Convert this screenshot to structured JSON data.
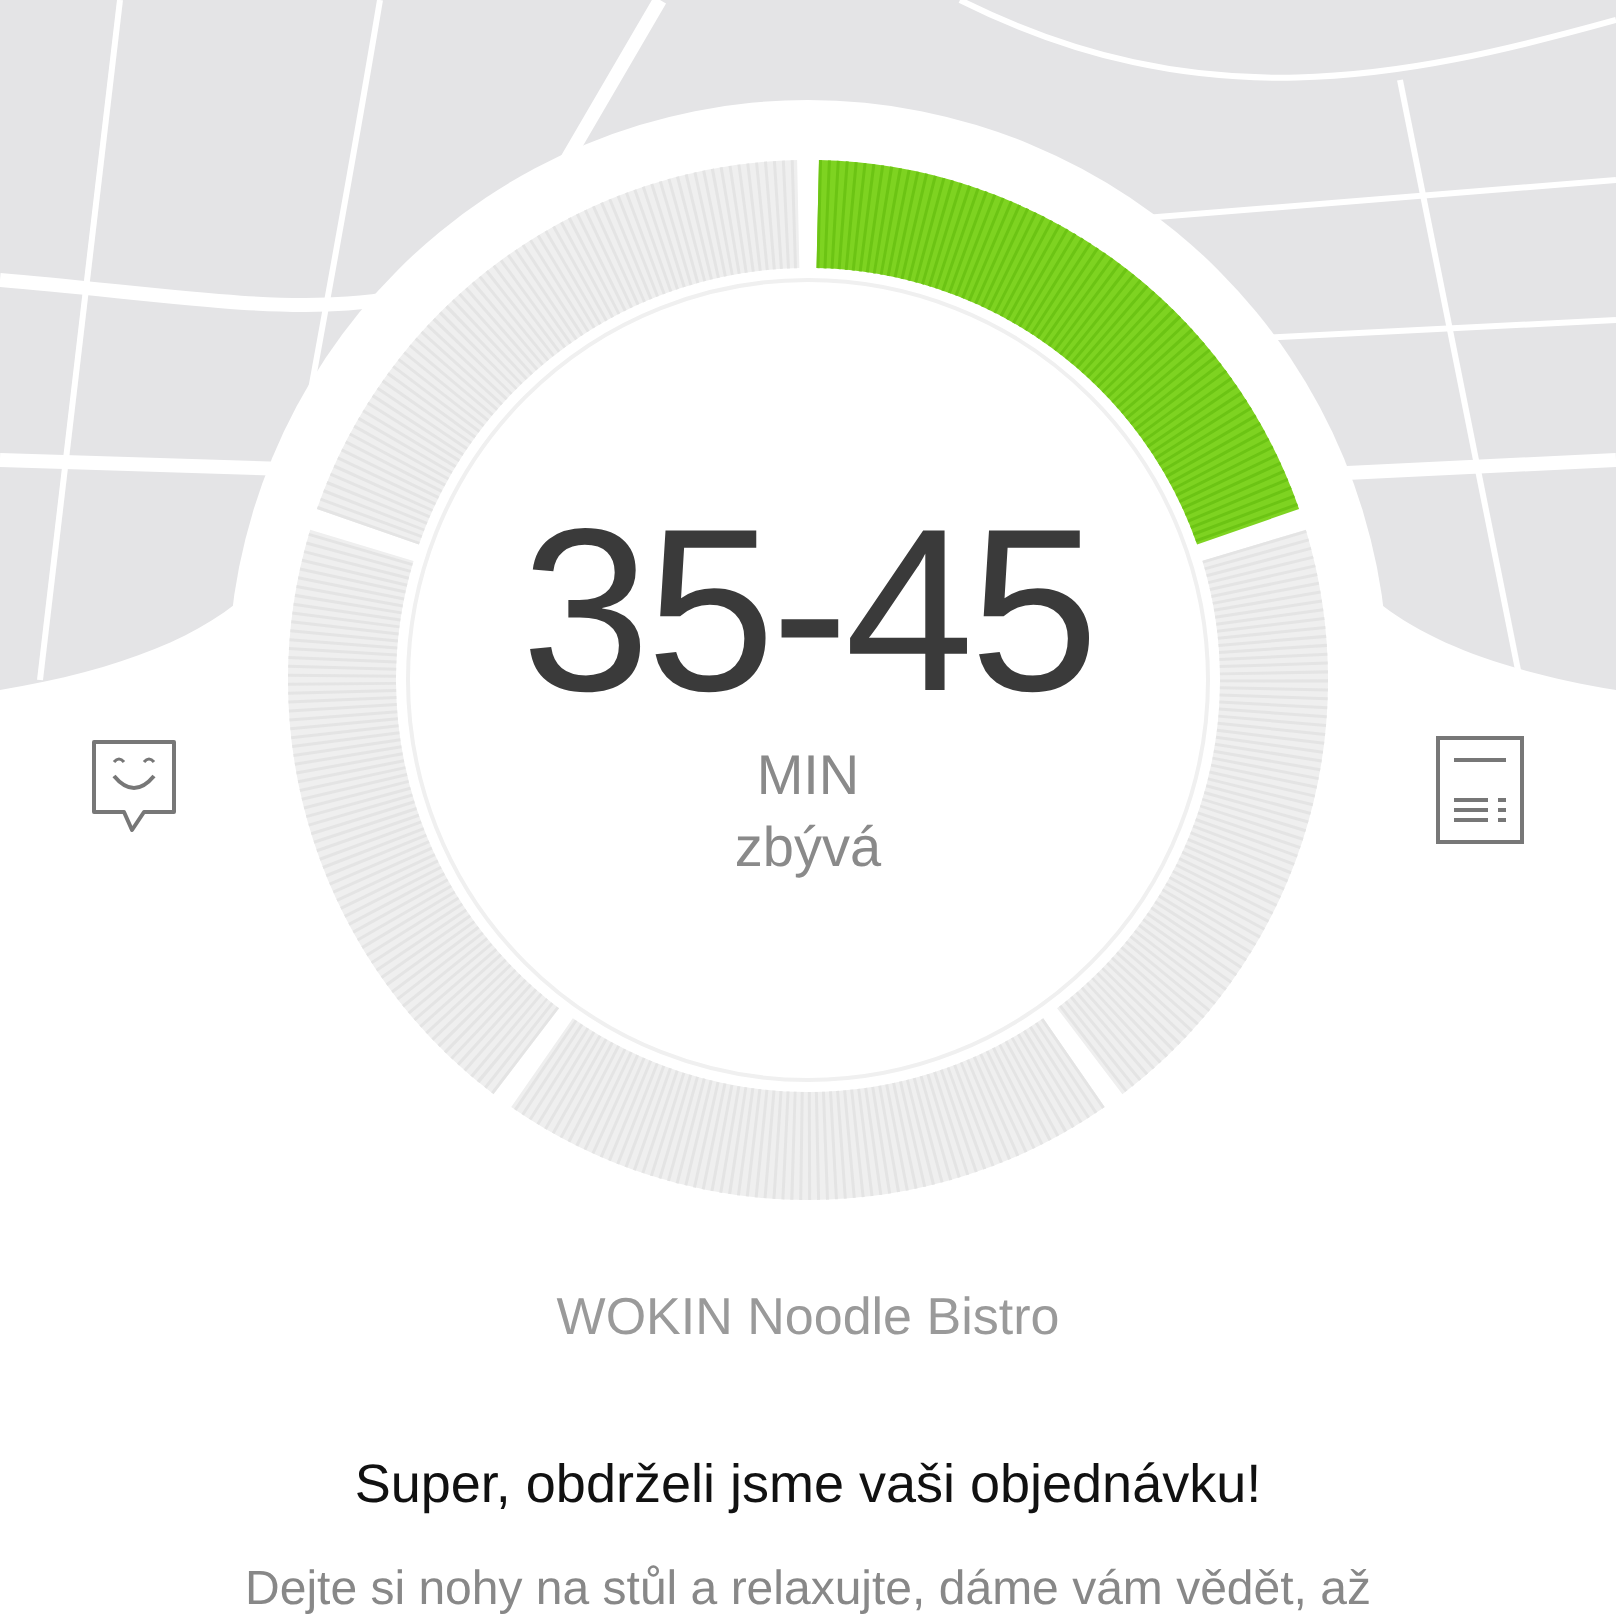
{
  "progress": {
    "segments": [
      {
        "filled": true
      },
      {
        "filled": false
      },
      {
        "filled": false
      },
      {
        "filled": false
      },
      {
        "filled": false
      }
    ]
  },
  "eta": {
    "range": "35-45",
    "unit": "MIN",
    "label": "zbývá"
  },
  "restaurant": "WOKIN Noodle Bistro",
  "message": {
    "title": "Super, obdrželi jsme vaši objednávku!",
    "body": "Dejte si nohy na stůl a relaxujte, dáme vám vědět, až"
  }
}
